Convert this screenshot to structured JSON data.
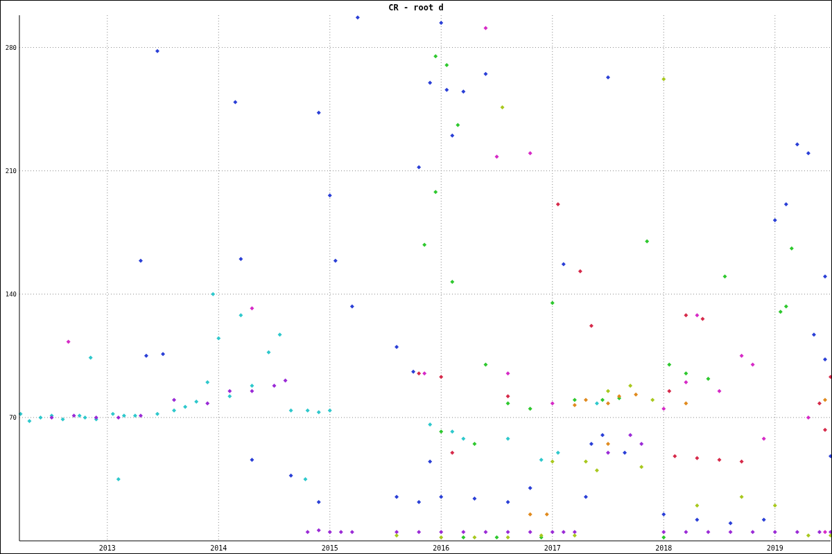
{
  "chart_data": {
    "type": "scatter",
    "title": "CR - root d",
    "xlim": [
      2012.21,
      2019.5
    ],
    "ylim": [
      0,
      298.3
    ],
    "xticks": [
      2013,
      2014,
      2015,
      2016,
      2017,
      2018,
      2019
    ],
    "yticks": [
      70,
      140,
      210,
      280
    ],
    "grid": true,
    "series": [
      {
        "color": "#2ec8cc",
        "x": [
          2012.22,
          2012.3,
          2012.4,
          2012.5,
          2012.6,
          2012.75,
          2012.8,
          2012.9,
          2013.05,
          2013.15,
          2013.25,
          2013.45,
          2013.6,
          2013.7,
          2013.8,
          2013.9,
          2014.0,
          2014.1,
          2014.2,
          2014.3,
          2014.45,
          2014.55,
          2014.65,
          2014.8,
          2014.9,
          2015.0,
          2014.78,
          2013.1,
          2012.85,
          2013.95,
          2015.9,
          2016.1,
          2016.2,
          2016.6,
          2016.9,
          2017.05,
          2017.4
        ],
        "values": [
          72,
          68,
          70,
          71,
          69,
          71,
          70,
          69,
          72,
          71,
          71,
          72,
          74,
          76,
          79,
          90,
          115,
          82,
          128,
          88,
          107,
          117,
          74,
          74,
          73,
          74,
          35,
          35,
          104,
          140,
          66,
          62,
          58,
          58,
          46,
          50,
          78
        ]
      },
      {
        "color": "#2a3fd6",
        "x": [
          2013.3,
          2013.45,
          2013.35,
          2014.15,
          2014.2,
          2014.3,
          2013.5,
          2014.9,
          2015.0,
          2015.05,
          2015.2,
          2015.25,
          2014.65,
          2014.9,
          2015.6,
          2015.75,
          2015.9,
          2016.0,
          2016.1,
          2016.05,
          2016.2,
          2016.4,
          2015.9,
          2015.8,
          2015.6,
          2015.8,
          2016.0,
          2016.3,
          2016.6,
          2016.8,
          2017.1,
          2017.3,
          2017.35,
          2017.45,
          2017.5,
          2017.65,
          2018.0,
          2018.3,
          2018.6,
          2018.9,
          2019.0,
          2019.1,
          2019.2,
          2019.3,
          2019.35,
          2019.45,
          2019.45,
          2019.5
        ],
        "values": [
          159,
          278,
          105,
          249,
          160,
          46,
          106,
          243,
          196,
          159,
          133,
          297,
          37,
          22,
          110,
          96,
          45,
          294,
          230,
          256,
          255,
          265,
          260,
          212,
          25,
          22,
          25,
          24,
          22,
          30,
          157,
          25,
          55,
          60,
          263,
          50,
          15,
          12,
          10,
          12,
          182,
          191,
          225,
          220,
          117,
          150,
          103,
          48
        ]
      },
      {
        "color": "#9a2ad6",
        "x": [
          2012.5,
          2012.7,
          2012.9,
          2013.1,
          2013.3,
          2013.6,
          2013.9,
          2014.1,
          2014.3,
          2014.5,
          2014.6,
          2014.8,
          2014.9,
          2015.0,
          2015.1,
          2015.2,
          2015.6,
          2015.8,
          2016.0,
          2016.2,
          2016.4,
          2016.6,
          2016.8,
          2017.0,
          2017.1,
          2017.2,
          2017.5,
          2017.7,
          2017.8,
          2018.0,
          2018.2,
          2018.4,
          2018.6,
          2018.8,
          2019.0,
          2019.2,
          2019.4,
          2019.5
        ],
        "values": [
          70,
          71,
          70,
          70,
          71,
          80,
          78,
          85,
          85,
          88,
          91,
          5,
          6,
          5,
          5,
          5,
          5,
          5,
          5,
          5,
          5,
          5,
          5,
          5,
          5,
          5,
          50,
          60,
          55,
          5,
          5,
          5,
          5,
          5,
          5,
          5,
          5,
          5
        ]
      },
      {
        "color": "#d62ac6",
        "x": [
          2012.65,
          2014.3,
          2015.85,
          2016.5,
          2016.8,
          2016.4,
          2016.6,
          2017.0,
          2018.0,
          2018.2,
          2018.5,
          2018.7,
          2018.9,
          2019.3,
          2019.45,
          2018.3,
          2018.8
        ],
        "values": [
          113,
          132,
          95,
          218,
          220,
          291,
          95,
          78,
          75,
          90,
          85,
          105,
          58,
          70,
          5,
          128,
          100
        ]
      },
      {
        "color": "#2ec82e",
        "x": [
          2015.95,
          2016.05,
          2016.15,
          2015.95,
          2016.1,
          2015.85,
          2016.0,
          2016.3,
          2016.6,
          2016.8,
          2017.0,
          2017.2,
          2017.45,
          2017.6,
          2017.85,
          2018.05,
          2018.2,
          2018.4,
          2018.55,
          2019.05,
          2019.1,
          2019.15,
          2018.0,
          2016.4,
          2016.2,
          2016.5,
          2016.9
        ],
        "values": [
          275,
          270,
          236,
          198,
          147,
          168,
          62,
          55,
          78,
          75,
          135,
          80,
          80,
          81,
          170,
          100,
          95,
          92,
          150,
          130,
          133,
          166,
          2,
          100,
          2,
          2,
          2
        ]
      },
      {
        "color": "#a8c81e",
        "x": [
          2015.6,
          2016.0,
          2016.3,
          2016.6,
          2016.9,
          2017.2,
          2016.55,
          2017.0,
          2017.3,
          2017.5,
          2017.7,
          2018.0,
          2017.9,
          2018.3,
          2018.7,
          2019.0,
          2019.3,
          2019.5,
          2017.4,
          2017.8
        ],
        "values": [
          3,
          2,
          2,
          2,
          3,
          3,
          246,
          45,
          45,
          85,
          88,
          262,
          80,
          20,
          25,
          20,
          3,
          3,
          40,
          42
        ]
      },
      {
        "color": "#d62a4a",
        "x": [
          2015.8,
          2016.0,
          2016.1,
          2016.6,
          2017.05,
          2017.25,
          2017.35,
          2018.05,
          2018.1,
          2018.3,
          2018.5,
          2018.7,
          2018.2,
          2018.35,
          2019.4,
          2019.45,
          2019.5
        ],
        "values": [
          95,
          93,
          50,
          82,
          191,
          153,
          122,
          85,
          48,
          47,
          46,
          45,
          128,
          126,
          78,
          63,
          93
        ]
      },
      {
        "color": "#e08a1e",
        "x": [
          2017.3,
          2017.5,
          2017.6,
          2017.75,
          2017.2,
          2016.8,
          2016.95,
          2019.45,
          2017.5,
          2018.2
        ],
        "values": [
          80,
          78,
          82,
          83,
          77,
          15,
          15,
          80,
          55,
          78
        ]
      }
    ]
  }
}
